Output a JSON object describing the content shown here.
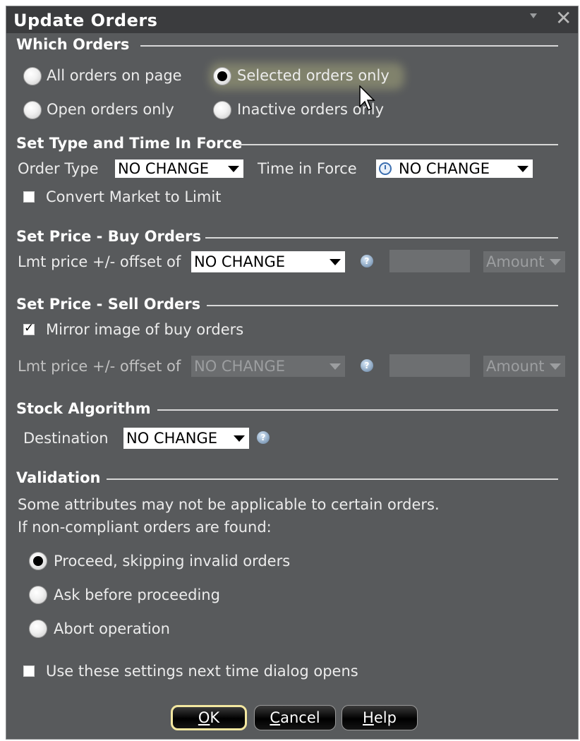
{
  "window": {
    "title": "Update Orders"
  },
  "which_orders": {
    "heading": "Which Orders",
    "options": [
      {
        "label": "All orders on page",
        "selected": false
      },
      {
        "label": "Selected orders only",
        "selected": true
      },
      {
        "label": "Open orders only",
        "selected": false
      },
      {
        "label": "Inactive orders only",
        "selected": false
      }
    ]
  },
  "type_tif": {
    "heading": "Set Type and Time In Force",
    "order_type_label": "Order Type",
    "order_type_value": "NO CHANGE",
    "tif_label": "Time in Force",
    "tif_value": "NO CHANGE",
    "convert_label": "Convert Market to Limit",
    "convert_checked": false
  },
  "buy_orders": {
    "heading": "Set Price - Buy Orders",
    "offset_label": "Lmt price +/- offset of",
    "offset_value": "NO CHANGE",
    "amount_value": "",
    "unit_value": "Amount"
  },
  "sell_orders": {
    "heading": "Set Price - Sell Orders",
    "mirror_label": "Mirror image of buy orders",
    "mirror_checked": true,
    "offset_label": "Lmt price +/- offset of",
    "offset_value": "NO CHANGE",
    "amount_value": "",
    "unit_value": "Amount"
  },
  "algorithm": {
    "heading": "Stock Algorithm",
    "destination_label": "Destination",
    "destination_value": "NO CHANGE"
  },
  "validation": {
    "heading": "Validation",
    "line1": "Some attributes may not be applicable to certain orders.",
    "line2": "If non-compliant orders are found:",
    "options": [
      {
        "label": "Proceed, skipping invalid orders",
        "selected": true
      },
      {
        "label": "Ask before proceeding",
        "selected": false
      },
      {
        "label": "Abort operation",
        "selected": false
      }
    ],
    "remember_label": "Use these settings next time dialog opens",
    "remember_checked": false
  },
  "buttons": {
    "ok_mnemonic": "O",
    "ok_rest": "K",
    "cancel_mnemonic": "C",
    "cancel_rest": "ancel",
    "help_mnemonic": "H",
    "help_rest": "elp"
  },
  "icons": {
    "help": "help-icon",
    "clock": "clock-icon",
    "close": "close-icon",
    "menu": "chevron-down-icon",
    "cursor": "mouse-cursor-icon"
  },
  "colors": {
    "window_bg": "#585a5c",
    "titlebar_bg": "#3b3c3e",
    "default_button_border": "#f3e7a0"
  }
}
